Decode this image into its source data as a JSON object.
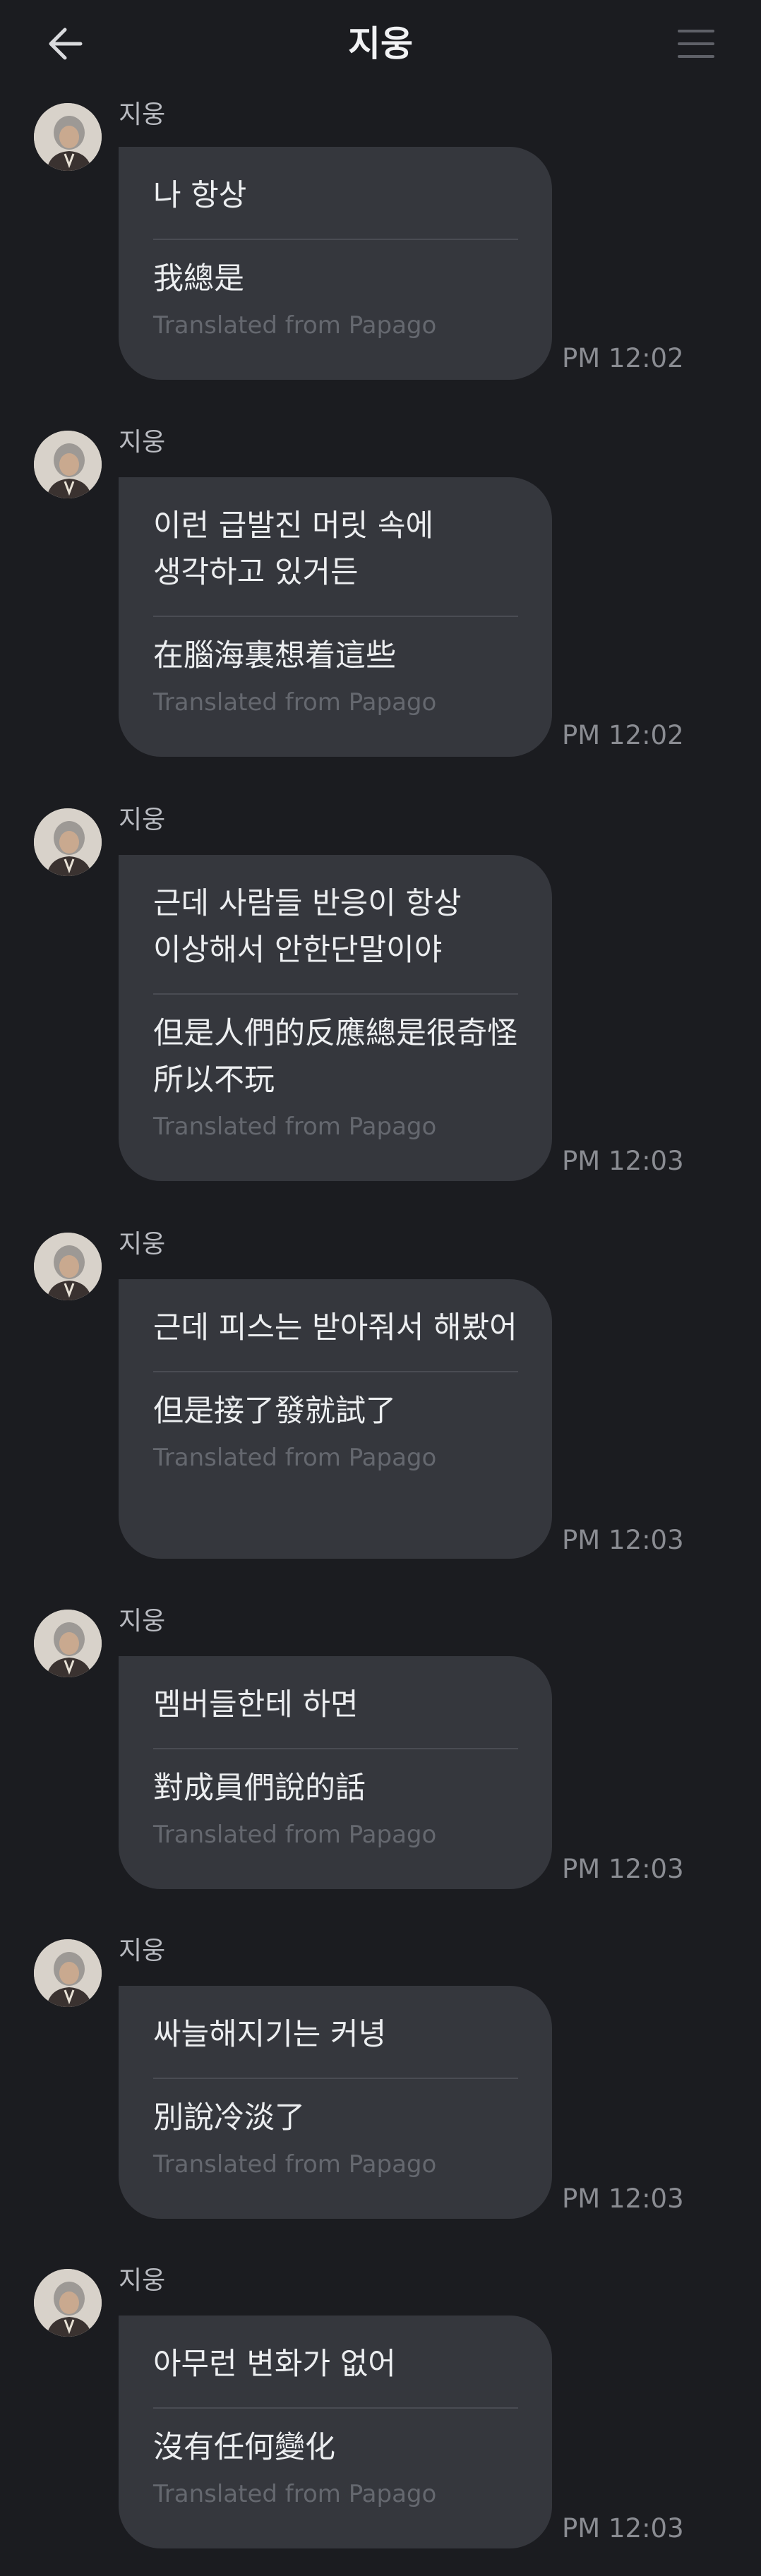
{
  "header": {
    "title": "지웅",
    "back_icon": "arrow-left-icon",
    "menu_icon": "hamburger-menu-icon"
  },
  "messages": [
    {
      "sender": "지웅",
      "original": "나 항상",
      "translated": "我總是",
      "translated_from": "Translated from Papago",
      "time": "PM 12:02"
    },
    {
      "sender": "지웅",
      "original": "이런 급발진 머릿 속에 생각하고 있거든",
      "translated": "在腦海裏想着這些",
      "translated_from": "Translated from Papago",
      "time": "PM 12:02"
    },
    {
      "sender": "지웅",
      "original": "근데 사람들 반응이 항상 이상해서 안한단말이야",
      "translated": "但是人們的反應總是很奇怪 所以不玩",
      "translated_from": "Translated from Papago",
      "time": "PM 12:03"
    },
    {
      "sender": "지웅",
      "original": "근데 피스는 받아줘서 해봤어",
      "translated": "但是接了發就試了",
      "translated_from": "Translated from Papago",
      "time": "PM 12:03"
    },
    {
      "sender": "지웅",
      "original": "멤버들한테 하면",
      "translated": "對成員們說的話",
      "translated_from": "Translated from Papago",
      "time": "PM 12:03"
    },
    {
      "sender": "지웅",
      "original": "싸늘해지기는 커녕",
      "translated": "別說冷淡了",
      "translated_from": "Translated from Papago",
      "time": "PM 12:03"
    },
    {
      "sender": "지웅",
      "original": "아무런 변화가 없어",
      "translated": "沒有任何變化",
      "translated_from": "Translated from Papago",
      "time": "PM 12:03"
    }
  ]
}
